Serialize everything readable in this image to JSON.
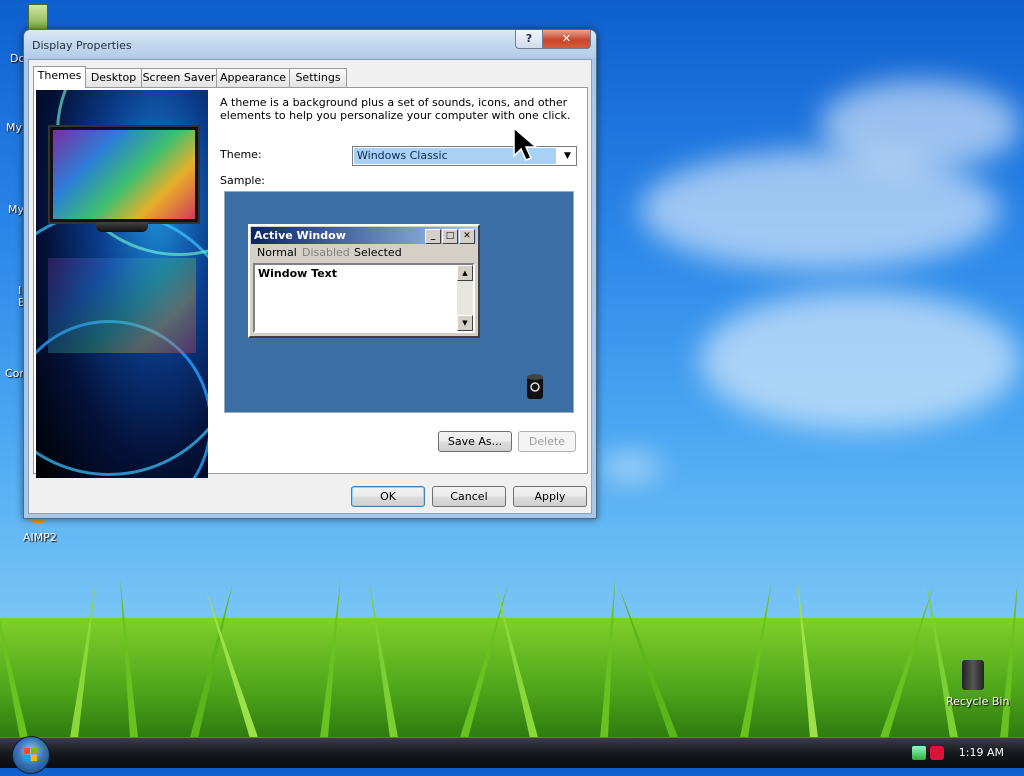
{
  "desktop": {
    "labels": {
      "documents": "Do",
      "my_computer": "My",
      "my_network": "My",
      "ie": "I\nE",
      "control": "Cor",
      "aimp": "AIMP2",
      "recycle_bin": "Recycle Bin"
    }
  },
  "window": {
    "title": "Display Properties",
    "help_label": "?",
    "close_label": "✕",
    "tabs": [
      "Themes",
      "Desktop",
      "Screen Saver",
      "Appearance",
      "Settings"
    ],
    "description": "A theme is a background plus a set of sounds, icons, and other elements to help you personalize your computer with one click.",
    "theme_label": "Theme:",
    "theme_value": "Windows Classic",
    "sample_label": "Sample:",
    "sample": {
      "title": "Active Window",
      "menu": [
        "Normal",
        "Disabled",
        "Selected"
      ],
      "body_text": "Window Text"
    },
    "buttons": {
      "save_as": "Save As...",
      "delete": "Delete",
      "ok": "OK",
      "cancel": "Cancel",
      "apply": "Apply"
    }
  },
  "taskbar": {
    "clock": "1:19 AM"
  },
  "colors": {
    "titlebar_classic": "#0a246a",
    "sample_bg": "#3a6ea5",
    "selection": "#a9d0f5"
  }
}
